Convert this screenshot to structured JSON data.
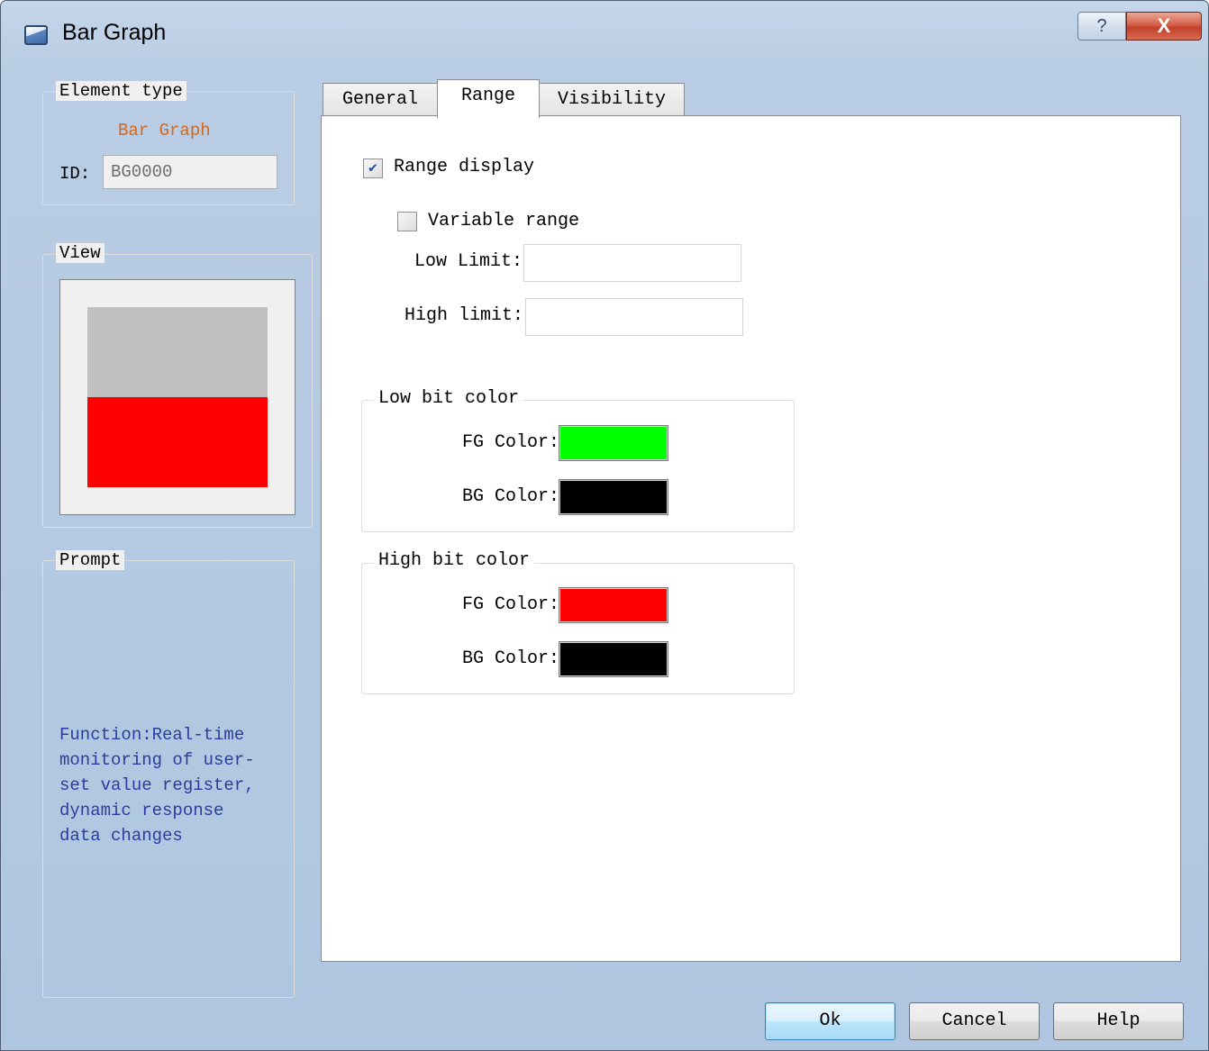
{
  "window": {
    "title": "Bar Graph",
    "help_glyph": "?",
    "close_glyph": "X"
  },
  "left": {
    "element_type": {
      "legend": "Element type",
      "value": "Bar Graph"
    },
    "id": {
      "label": "ID:",
      "value": "BG0000"
    },
    "view": {
      "legend": "View",
      "empty_color": "#c0c0c0",
      "fill_color": "#ff0000",
      "fill_fraction": 0.5
    },
    "prompt": {
      "legend": "Prompt",
      "text": "Function:Real-time\nmonitoring of user-\nset value register,\ndynamic response\ndata changes"
    }
  },
  "tabs": [
    {
      "label": "General",
      "active": false
    },
    {
      "label": "Range",
      "active": true
    },
    {
      "label": "Visibility",
      "active": false
    }
  ],
  "range_tab": {
    "range_display": {
      "label": "Range display",
      "checked": true
    },
    "variable_range": {
      "label": "Variable range",
      "checked": false
    },
    "low_limit": {
      "label": "Low Limit:",
      "value": ""
    },
    "high_limit": {
      "label": "High limit:",
      "value": ""
    },
    "low_bit_color": {
      "legend": "Low bit color",
      "fg_label": "FG Color:",
      "fg_color": "#00ff00",
      "bg_label": "BG Color:",
      "bg_color": "#000000"
    },
    "high_bit_color": {
      "legend": "High bit color",
      "fg_label": "FG Color:",
      "fg_color": "#ff0000",
      "bg_label": "BG Color:",
      "bg_color": "#000000"
    }
  },
  "buttons": {
    "ok": "Ok",
    "cancel": "Cancel",
    "help": "Help"
  }
}
